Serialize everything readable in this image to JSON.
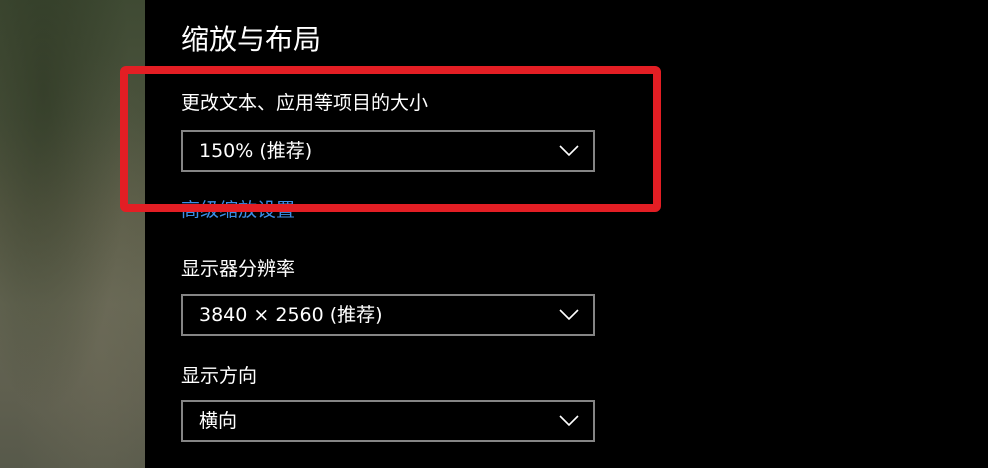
{
  "section": {
    "title": "缩放与布局"
  },
  "scale": {
    "label": "更改文本、应用等项目的大小",
    "selected": "150% (推荐)"
  },
  "advanced_link": {
    "label": "高级缩放设置"
  },
  "resolution": {
    "label": "显示器分辨率",
    "selected": "3840 × 2560 (推荐)"
  },
  "orientation": {
    "label": "显示方向",
    "selected": "横向"
  },
  "icons": {
    "dropdown": "chevron-down-icon"
  },
  "colors": {
    "background": "#000000",
    "text": "#ffffff",
    "link": "#3b8ee8",
    "dropdown_border": "#858585",
    "annotation": "#e31e24"
  }
}
